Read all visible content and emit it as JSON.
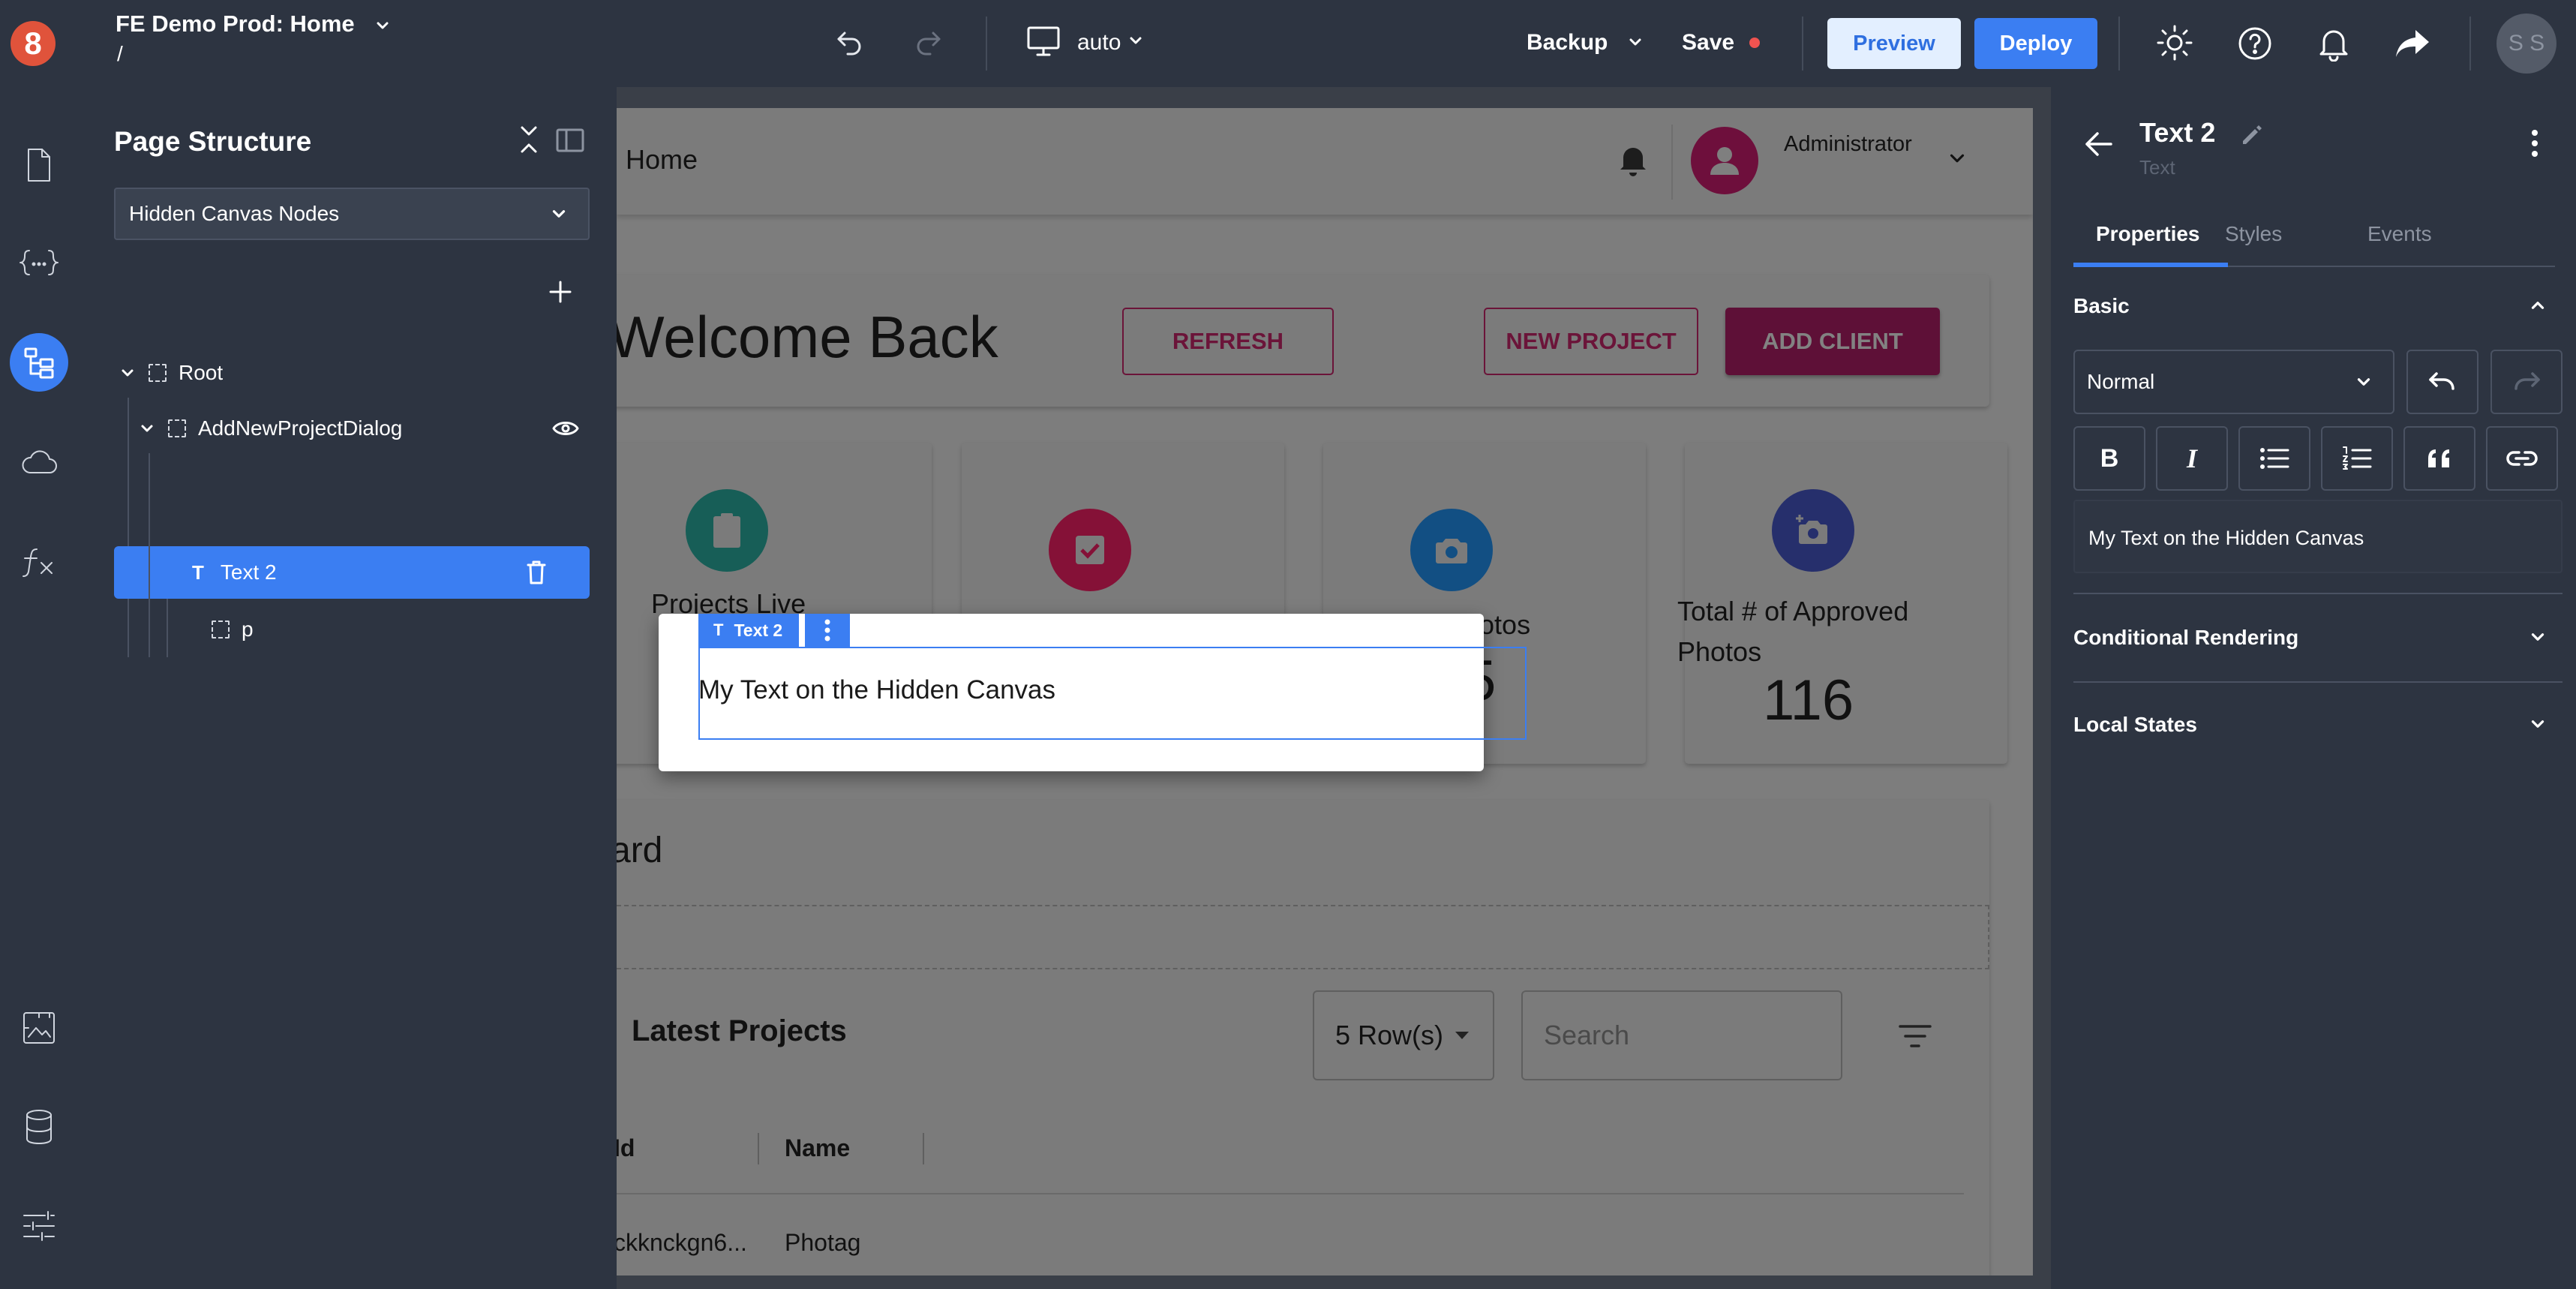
{
  "topbar": {
    "project_title": "FE Demo Prod: Home",
    "path": "/",
    "device_label": "auto",
    "backup_label": "Backup",
    "save_label": "Save",
    "preview_label": "Preview",
    "deploy_label": "Deploy",
    "avatar_initials": "S S",
    "accent": "#3b7ef2",
    "save_dot_color": "#ef5350"
  },
  "rail": {
    "logo": "8",
    "icons": [
      "page-icon",
      "variables-icon",
      "structure-icon",
      "cloud-icon",
      "function-icon",
      "media-icon",
      "database-icon",
      "settings-sliders-icon"
    ]
  },
  "left_panel": {
    "title": "Page Structure",
    "dropdown_value": "Hidden Canvas Nodes",
    "tree": [
      {
        "label": "Root"
      },
      {
        "label": "AddNewProjectDialog"
      },
      {
        "label": "Text 2"
      },
      {
        "label": "p"
      }
    ]
  },
  "canvas": {
    "header": {
      "title": "Home",
      "user": "Administrator"
    },
    "welcome": "Welcome Back",
    "buttons": {
      "refresh": "REFRESH",
      "new_project": "NEW PROJECT",
      "add_client": "ADD CLIENT"
    },
    "cards": [
      {
        "label": "Projects Live",
        "value": "",
        "icon_color": "#26a69a"
      },
      {
        "label": "",
        "value": "",
        "icon_color": "#e91e63"
      },
      {
        "label": "hotos",
        "value": "5",
        "icon_color": "#1e88e5"
      },
      {
        "label": "Total # of Approved Photos",
        "value": "116",
        "icon_color": "#3f51b5"
      }
    ],
    "section_title": "ard",
    "table": {
      "title": "Latest Projects",
      "rows_select": "5 Row(s)",
      "search_placeholder": "Search",
      "columns": [
        "Id",
        "Name"
      ],
      "rows": [
        [
          "ckknckgn6...",
          "Photag"
        ]
      ]
    },
    "dialog": {
      "tag_label": "Text 2",
      "text": "My Text on the Hidden Canvas"
    },
    "brand_color": "#c2185b"
  },
  "right_panel": {
    "title": "Text 2",
    "subtitle": "Text",
    "tabs": [
      "Properties",
      "Styles",
      "Events"
    ],
    "basic_label": "Basic",
    "text_style": "Normal",
    "content_text": "My Text on the Hidden Canvas",
    "conditional_label": "Conditional Rendering",
    "local_states_label": "Local States"
  }
}
